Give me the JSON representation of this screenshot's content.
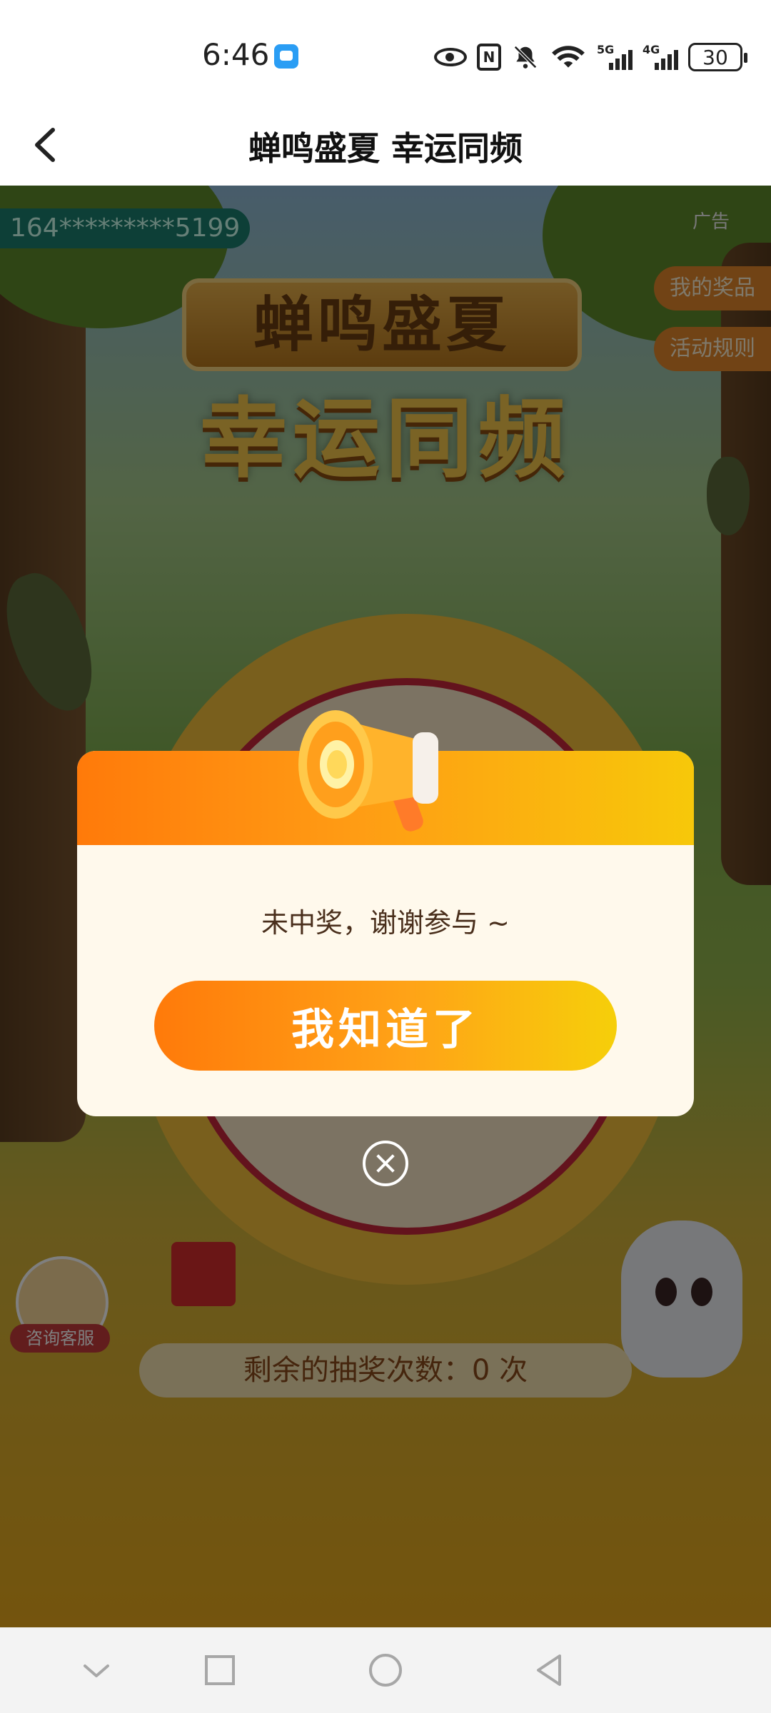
{
  "status_bar": {
    "time": "6:46",
    "icons": [
      "message-icon",
      "eye-icon",
      "nfc-icon",
      "bell-off-icon",
      "wifi-icon",
      "signal-5g-icon",
      "signal-4g-icon",
      "battery-icon"
    ],
    "signal_5g_label": "5G",
    "signal_4g_label": "4G",
    "battery_level": "30"
  },
  "header": {
    "title": "蝉鸣盛夏 幸运同频"
  },
  "content": {
    "phone_masked": "164*********5199",
    "ad_label": "广告",
    "my_prizes_label": "我的奖品",
    "rules_label": "活动规则",
    "banner_top": "蝉鸣盛夏",
    "banner_main": "幸运同频",
    "service_label": "咨询客服",
    "remaining_draws": "剩余的抽奖次数：0 次"
  },
  "dialog": {
    "message": "未中奖，谢谢参与 ~",
    "confirm_label": "我知道了"
  },
  "colors": {
    "dialog_gradient_start": "#ff7a0a",
    "dialog_gradient_end": "#f7c80a",
    "dialog_body": "#fff9ec",
    "overlay": "rgba(0,0,0,0.5)"
  }
}
